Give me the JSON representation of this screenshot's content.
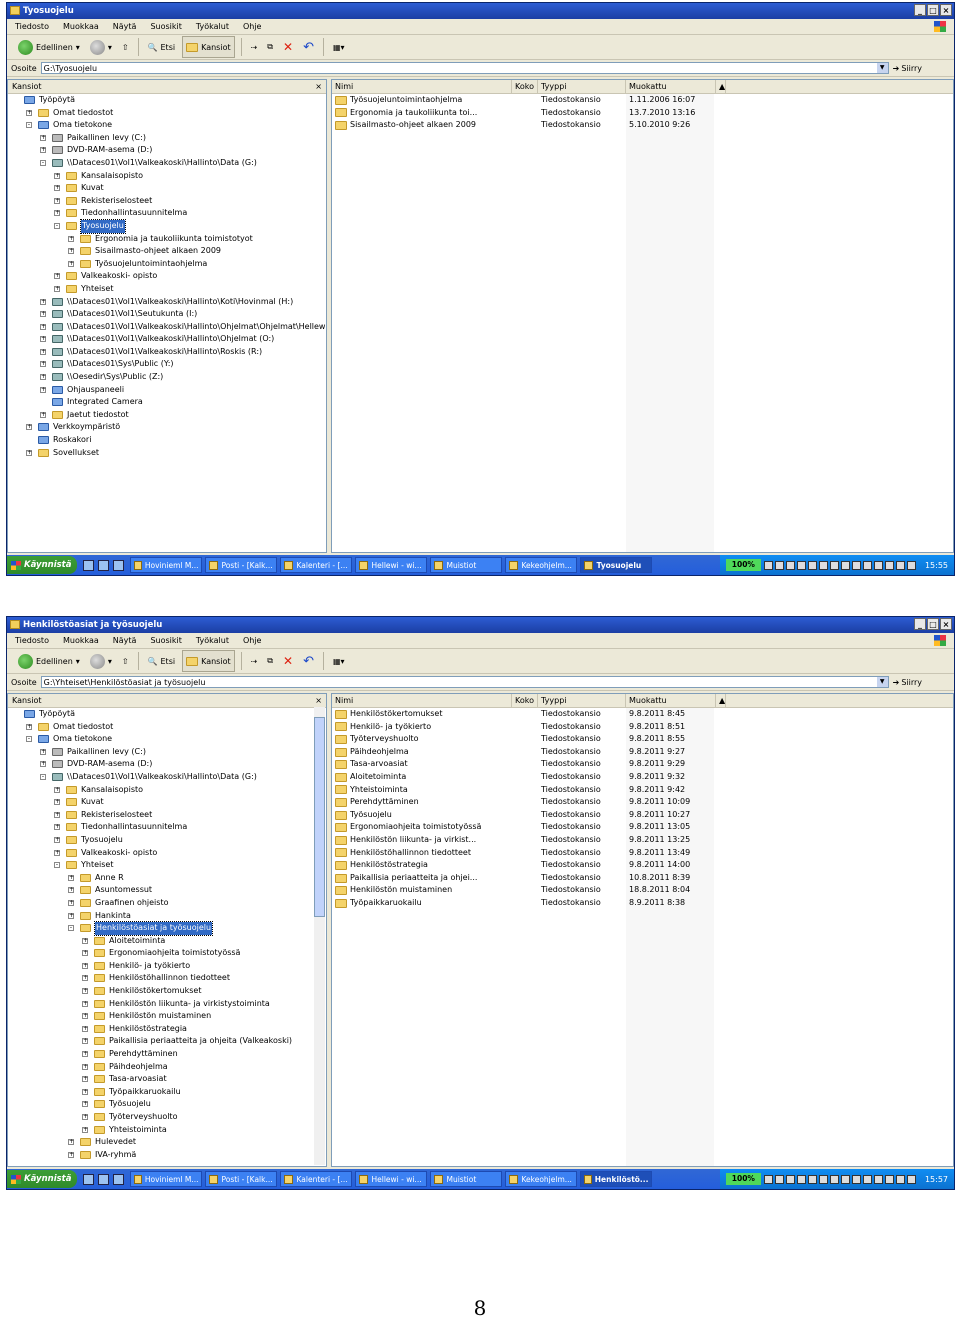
{
  "windows": [
    {
      "title": "Tyosuojelu",
      "menu": [
        "Tiedosto",
        "Muokkaa",
        "Näytä",
        "Suosikit",
        "Työkalut",
        "Ohje"
      ],
      "toolbar": {
        "back": "Edellinen",
        "search": "Etsi",
        "folders": "Kansiot"
      },
      "address": {
        "label": "Osoite",
        "value": "G:\\Tyosuojelu",
        "go": "Siirry"
      },
      "folders_pane": {
        "title": "Kansiot"
      },
      "tree": [
        {
          "label": "Työpöytä",
          "lvl": 0,
          "pm": "",
          "icon": "sys"
        },
        {
          "label": "Omat tiedostot",
          "lvl": 1,
          "pm": "+",
          "icon": "f"
        },
        {
          "label": "Oma tietokone",
          "lvl": 1,
          "pm": "-",
          "icon": "sys"
        },
        {
          "label": "Paikallinen levy (C:)",
          "lvl": 2,
          "pm": "+",
          "icon": "drv"
        },
        {
          "label": "DVD-RAM-asema (D:)",
          "lvl": 2,
          "pm": "+",
          "icon": "drv"
        },
        {
          "label": "\\\\Dataces01\\Vol1\\Valkeakoski\\Hallinto\\Data (G:)",
          "lvl": 2,
          "pm": "-",
          "icon": "net"
        },
        {
          "label": "Kansalaisopisto",
          "lvl": 3,
          "pm": "+",
          "icon": "f"
        },
        {
          "label": "Kuvat",
          "lvl": 3,
          "pm": "+",
          "icon": "f"
        },
        {
          "label": "Rekisteriselosteet",
          "lvl": 3,
          "pm": "+",
          "icon": "f"
        },
        {
          "label": "Tiedonhallintasuunnitelma",
          "lvl": 3,
          "pm": "+",
          "icon": "f"
        },
        {
          "label": "Tyosuojelu",
          "lvl": 3,
          "pm": "-",
          "icon": "f",
          "sel": true
        },
        {
          "label": "Ergonomia ja taukoliikunta toimistotyot",
          "lvl": 4,
          "pm": "+",
          "icon": "f"
        },
        {
          "label": "Sisailmasto-ohjeet alkaen 2009",
          "lvl": 4,
          "pm": "+",
          "icon": "f"
        },
        {
          "label": "Työsuojeluntoimintaohjelma",
          "lvl": 4,
          "pm": "+",
          "icon": "f"
        },
        {
          "label": "Valkeakoski- opisto",
          "lvl": 3,
          "pm": "+",
          "icon": "f"
        },
        {
          "label": "Yhteiset",
          "lvl": 3,
          "pm": "+",
          "icon": "f"
        },
        {
          "label": "\\\\Dataces01\\Vol1\\Valkeakoski\\Hallinto\\Koti\\Hovinmal (H:)",
          "lvl": 2,
          "pm": "+",
          "icon": "net"
        },
        {
          "label": "\\\\Dataces01\\Vol1\\Seutukunta (I:)",
          "lvl": 2,
          "pm": "+",
          "icon": "net"
        },
        {
          "label": "\\\\Dataces01\\Vol1\\Valkeakoski\\Hallinto\\Ohjelmat\\Ohjelmat\\Hellewi (K:)",
          "lvl": 2,
          "pm": "+",
          "icon": "net"
        },
        {
          "label": "\\\\Dataces01\\Vol1\\Valkeakoski\\Hallinto\\Ohjelmat (O:)",
          "lvl": 2,
          "pm": "+",
          "icon": "net"
        },
        {
          "label": "\\\\Dataces01\\Vol1\\Valkeakoski\\Hallinto\\Roskis (R:)",
          "lvl": 2,
          "pm": "+",
          "icon": "net"
        },
        {
          "label": "\\\\Dataces01\\Sys\\Public (Y:)",
          "lvl": 2,
          "pm": "+",
          "icon": "net"
        },
        {
          "label": "\\\\Oesedir\\Sys\\Public (Z:)",
          "lvl": 2,
          "pm": "+",
          "icon": "net"
        },
        {
          "label": "Ohjauspaneeli",
          "lvl": 2,
          "pm": "+",
          "icon": "sys"
        },
        {
          "label": "Integrated Camera",
          "lvl": 2,
          "pm": "",
          "icon": "sys"
        },
        {
          "label": "Jaetut tiedostot",
          "lvl": 2,
          "pm": "+",
          "icon": "f"
        },
        {
          "label": "Verkkoympäristö",
          "lvl": 1,
          "pm": "+",
          "icon": "sys"
        },
        {
          "label": "Roskakori",
          "lvl": 1,
          "pm": "",
          "icon": "sys"
        },
        {
          "label": "Sovellukset",
          "lvl": 1,
          "pm": "+",
          "icon": "f"
        }
      ],
      "tree_scroll": false,
      "columns": [
        "Nimi",
        "Koko",
        "Tyyppi",
        "Muokattu"
      ],
      "files": [
        {
          "name": "Työsuojeluntoimintaohjelma",
          "type": "Tiedostokansio",
          "modified": "1.11.2006 16:07"
        },
        {
          "name": "Ergonomia ja taukoliikunta toi...",
          "type": "Tiedostokansio",
          "modified": "13.7.2010 13:16"
        },
        {
          "name": "Sisailmasto-ohjeet alkaen 2009",
          "type": "Tiedostokansio",
          "modified": "5.10.2010 9:26"
        }
      ],
      "taskbar": {
        "start": "Käynnistä",
        "tasks": [
          "Hovinieml M...",
          "Posti - [Kalk...",
          "Kalenteri - [...",
          "Hellewi - wi...",
          "Muistiot",
          "Kekeohjelm...",
          "Tyosuojelu"
        ],
        "active": 6,
        "zoom": "100%",
        "clock": "15:55"
      }
    },
    {
      "title": "Henkilöstöasiat ja työsuojelu",
      "menu": [
        "Tiedosto",
        "Muokkaa",
        "Näytä",
        "Suosikit",
        "Työkalut",
        "Ohje"
      ],
      "toolbar": {
        "back": "Edellinen",
        "search": "Etsi",
        "folders": "Kansiot"
      },
      "address": {
        "label": "Osoite",
        "value": "G:\\Yhteiset\\Henkilöstöasiat ja työsuojelu",
        "go": "Siirry"
      },
      "folders_pane": {
        "title": "Kansiot"
      },
      "tree": [
        {
          "label": "Työpöytä",
          "lvl": 0,
          "pm": "",
          "icon": "sys"
        },
        {
          "label": "Omat tiedostot",
          "lvl": 1,
          "pm": "+",
          "icon": "f"
        },
        {
          "label": "Oma tietokone",
          "lvl": 1,
          "pm": "-",
          "icon": "sys"
        },
        {
          "label": "Paikallinen levy (C:)",
          "lvl": 2,
          "pm": "+",
          "icon": "drv"
        },
        {
          "label": "DVD-RAM-asema (D:)",
          "lvl": 2,
          "pm": "+",
          "icon": "drv"
        },
        {
          "label": "\\\\Dataces01\\Vol1\\Valkeakoski\\Hallinto\\Data (G:)",
          "lvl": 2,
          "pm": "-",
          "icon": "net"
        },
        {
          "label": "Kansalaisopisto",
          "lvl": 3,
          "pm": "+",
          "icon": "f"
        },
        {
          "label": "Kuvat",
          "lvl": 3,
          "pm": "+",
          "icon": "f"
        },
        {
          "label": "Rekisteriselosteet",
          "lvl": 3,
          "pm": "+",
          "icon": "f"
        },
        {
          "label": "Tiedonhallintasuunnitelma",
          "lvl": 3,
          "pm": "+",
          "icon": "f"
        },
        {
          "label": "Tyosuojelu",
          "lvl": 3,
          "pm": "+",
          "icon": "f"
        },
        {
          "label": "Valkeakoski- opisto",
          "lvl": 3,
          "pm": "+",
          "icon": "f"
        },
        {
          "label": "Yhteiset",
          "lvl": 3,
          "pm": "-",
          "icon": "f"
        },
        {
          "label": "Anne R",
          "lvl": 4,
          "pm": "+",
          "icon": "f"
        },
        {
          "label": "Asuntomessut",
          "lvl": 4,
          "pm": "+",
          "icon": "f"
        },
        {
          "label": "Graafinen ohjeisto",
          "lvl": 4,
          "pm": "+",
          "icon": "f"
        },
        {
          "label": "Hankinta",
          "lvl": 4,
          "pm": "+",
          "icon": "f"
        },
        {
          "label": "Henkilöstöasiat ja työsuojelu",
          "lvl": 4,
          "pm": "-",
          "icon": "f",
          "sel": true
        },
        {
          "label": "Aloitetoiminta",
          "lvl": 5,
          "pm": "+",
          "icon": "f"
        },
        {
          "label": "Ergonomiaohjeita toimistotyössä",
          "lvl": 5,
          "pm": "+",
          "icon": "f"
        },
        {
          "label": "Henkilö- ja työkierto",
          "lvl": 5,
          "pm": "+",
          "icon": "f"
        },
        {
          "label": "Henkilöstöhallinnon tiedotteet",
          "lvl": 5,
          "pm": "+",
          "icon": "f"
        },
        {
          "label": "Henkilöstökertomukset",
          "lvl": 5,
          "pm": "+",
          "icon": "f"
        },
        {
          "label": "Henkilöstön liikunta- ja virkistystoiminta",
          "lvl": 5,
          "pm": "+",
          "icon": "f"
        },
        {
          "label": "Henkilöstön muistaminen",
          "lvl": 5,
          "pm": "+",
          "icon": "f"
        },
        {
          "label": "Henkilöstöstrategia",
          "lvl": 5,
          "pm": "+",
          "icon": "f"
        },
        {
          "label": "Paikallisia periaatteita ja ohjeita (Valkeakoski)",
          "lvl": 5,
          "pm": "+",
          "icon": "f"
        },
        {
          "label": "Perehdyttäminen",
          "lvl": 5,
          "pm": "+",
          "icon": "f"
        },
        {
          "label": "Päihdeohjelma",
          "lvl": 5,
          "pm": "+",
          "icon": "f"
        },
        {
          "label": "Tasa-arvoasiat",
          "lvl": 5,
          "pm": "+",
          "icon": "f"
        },
        {
          "label": "Työpaikkaruokailu",
          "lvl": 5,
          "pm": "+",
          "icon": "f"
        },
        {
          "label": "Työsuojelu",
          "lvl": 5,
          "pm": "+",
          "icon": "f"
        },
        {
          "label": "Työterveyshuolto",
          "lvl": 5,
          "pm": "+",
          "icon": "f"
        },
        {
          "label": "Yhteistoiminta",
          "lvl": 5,
          "pm": "+",
          "icon": "f"
        },
        {
          "label": "Hulevedet",
          "lvl": 4,
          "pm": "+",
          "icon": "f"
        },
        {
          "label": "IVA-ryhmä",
          "lvl": 4,
          "pm": "+",
          "icon": "f"
        }
      ],
      "tree_scroll": true,
      "columns": [
        "Nimi",
        "Koko",
        "Tyyppi",
        "Muokattu"
      ],
      "files": [
        {
          "name": "Henkilöstökertomukset",
          "type": "Tiedostokansio",
          "modified": "9.8.2011 8:45"
        },
        {
          "name": "Henkilö- ja työkierto",
          "type": "Tiedostokansio",
          "modified": "9.8.2011 8:51"
        },
        {
          "name": "Työterveyshuolto",
          "type": "Tiedostokansio",
          "modified": "9.8.2011 8:55"
        },
        {
          "name": "Päihdeohjelma",
          "type": "Tiedostokansio",
          "modified": "9.8.2011 9:27"
        },
        {
          "name": "Tasa-arvoasiat",
          "type": "Tiedostokansio",
          "modified": "9.8.2011 9:29"
        },
        {
          "name": "Aloitetoiminta",
          "type": "Tiedostokansio",
          "modified": "9.8.2011 9:32"
        },
        {
          "name": "Yhteistoiminta",
          "type": "Tiedostokansio",
          "modified": "9.8.2011 9:42"
        },
        {
          "name": "Perehdyttäminen",
          "type": "Tiedostokansio",
          "modified": "9.8.2011 10:09"
        },
        {
          "name": "Työsuojelu",
          "type": "Tiedostokansio",
          "modified": "9.8.2011 10:27"
        },
        {
          "name": "Ergonomiaohjeita toimistotyössä",
          "type": "Tiedostokansio",
          "modified": "9.8.2011 13:05"
        },
        {
          "name": "Henkilöstön liikunta- ja virkist...",
          "type": "Tiedostokansio",
          "modified": "9.8.2011 13:25"
        },
        {
          "name": "Henkilöstöhallinnon tiedotteet",
          "type": "Tiedostokansio",
          "modified": "9.8.2011 13:49"
        },
        {
          "name": "Henkilöstöstrategia",
          "type": "Tiedostokansio",
          "modified": "9.8.2011 14:00"
        },
        {
          "name": "Paikallisia periaatteita ja ohjei...",
          "type": "Tiedostokansio",
          "modified": "10.8.2011 8:39"
        },
        {
          "name": "Henkilöstön muistaminen",
          "type": "Tiedostokansio",
          "modified": "18.8.2011 8:04"
        },
        {
          "name": "Työpaikkaruokailu",
          "type": "Tiedostokansio",
          "modified": "8.9.2011 8:38"
        }
      ],
      "taskbar": {
        "start": "Käynnistä",
        "tasks": [
          "Hovinieml M...",
          "Posti - [Kalk...",
          "Kalenteri - [...",
          "Hellewi - wi...",
          "Muistiot",
          "Kekeohjelm...",
          "Henkilöstö..."
        ],
        "active": 6,
        "zoom": "100%",
        "clock": "15:57"
      }
    }
  ],
  "page_number": "8"
}
